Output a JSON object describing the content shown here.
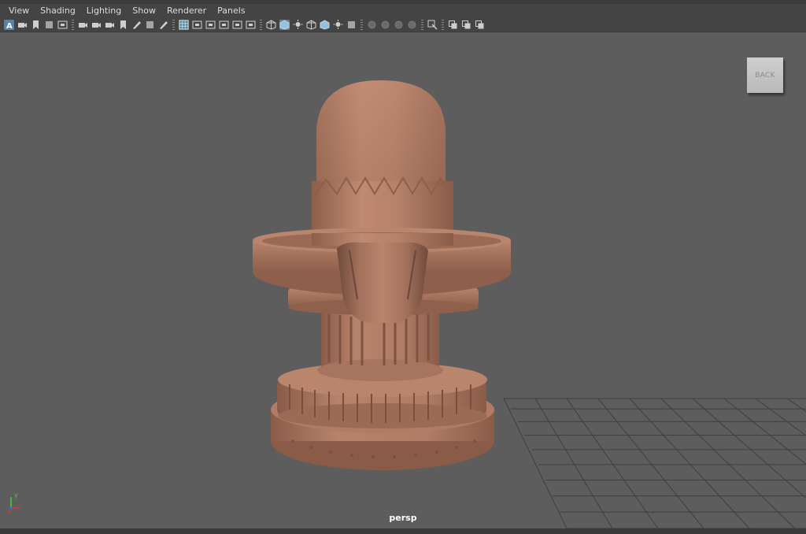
{
  "menubar": {
    "items": [
      "View",
      "Shading",
      "Lighting",
      "Show",
      "Renderer",
      "Panels"
    ]
  },
  "toolbar": {
    "groups": [
      [
        "select-camera-icon",
        "camera-attributes-icon",
        "bookmark-icon",
        "image-plane-icon",
        "film-gate-icon"
      ],
      [
        "camera-icon",
        "camera-tumble-icon",
        "camera-track-icon",
        "bookmark-flag-icon",
        "grease-pencil-icon",
        "look-at-icon",
        "paint-brush-icon"
      ],
      [
        "grid-icon",
        "resolution-gate-icon",
        "gate-mask-icon",
        "field-chart-icon",
        "safe-action-icon",
        "safe-title-icon"
      ],
      [
        "wireframe-icon",
        "smooth-shade-icon",
        "default-lighting-icon",
        "wireframe-on-shaded-icon",
        "textured-icon",
        "use-lights-icon",
        "shadows-icon"
      ],
      [
        "screen-space-ao-icon",
        "motion-blur-icon",
        "antialias-icon",
        "depth-of-field-icon"
      ],
      [
        "isolate-select-icon"
      ],
      [
        "xray-icon",
        "xray-joints-icon",
        "xray-active-icon"
      ]
    ],
    "active": [
      "select-camera-icon",
      "grid-icon",
      "smooth-shade-icon"
    ]
  },
  "viewcube": {
    "face_label": "BACK"
  },
  "viewport": {
    "camera_name": "persp"
  },
  "axis_gizmo": {
    "x_label": "x",
    "y_label": "y"
  },
  "colors": {
    "viewport_bg": "#5d5d5d",
    "menubar_bg": "#444444",
    "grid_line": "#3f3f3f",
    "model_base": "#b4826a",
    "model_shadow": "#7e5444",
    "highlight_blue": "#5285a6"
  }
}
